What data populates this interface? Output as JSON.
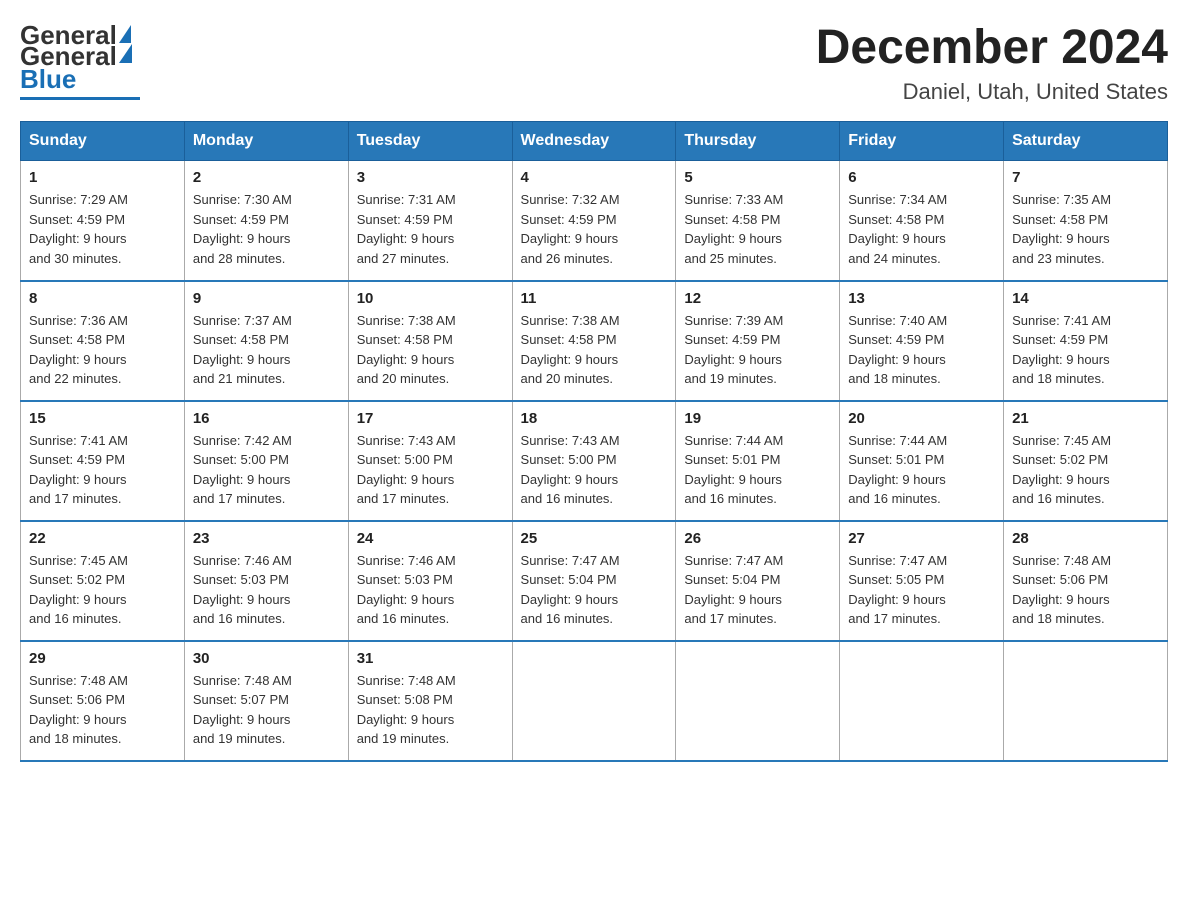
{
  "header": {
    "logo_general": "General",
    "logo_blue": "Blue",
    "month": "December 2024",
    "location": "Daniel, Utah, United States"
  },
  "days_of_week": [
    "Sunday",
    "Monday",
    "Tuesday",
    "Wednesday",
    "Thursday",
    "Friday",
    "Saturday"
  ],
  "weeks": [
    [
      {
        "day": "1",
        "sunrise": "7:29 AM",
        "sunset": "4:59 PM",
        "daylight": "9 hours and 30 minutes."
      },
      {
        "day": "2",
        "sunrise": "7:30 AM",
        "sunset": "4:59 PM",
        "daylight": "9 hours and 28 minutes."
      },
      {
        "day": "3",
        "sunrise": "7:31 AM",
        "sunset": "4:59 PM",
        "daylight": "9 hours and 27 minutes."
      },
      {
        "day": "4",
        "sunrise": "7:32 AM",
        "sunset": "4:59 PM",
        "daylight": "9 hours and 26 minutes."
      },
      {
        "day": "5",
        "sunrise": "7:33 AM",
        "sunset": "4:58 PM",
        "daylight": "9 hours and 25 minutes."
      },
      {
        "day": "6",
        "sunrise": "7:34 AM",
        "sunset": "4:58 PM",
        "daylight": "9 hours and 24 minutes."
      },
      {
        "day": "7",
        "sunrise": "7:35 AM",
        "sunset": "4:58 PM",
        "daylight": "9 hours and 23 minutes."
      }
    ],
    [
      {
        "day": "8",
        "sunrise": "7:36 AM",
        "sunset": "4:58 PM",
        "daylight": "9 hours and 22 minutes."
      },
      {
        "day": "9",
        "sunrise": "7:37 AM",
        "sunset": "4:58 PM",
        "daylight": "9 hours and 21 minutes."
      },
      {
        "day": "10",
        "sunrise": "7:38 AM",
        "sunset": "4:58 PM",
        "daylight": "9 hours and 20 minutes."
      },
      {
        "day": "11",
        "sunrise": "7:38 AM",
        "sunset": "4:58 PM",
        "daylight": "9 hours and 20 minutes."
      },
      {
        "day": "12",
        "sunrise": "7:39 AM",
        "sunset": "4:59 PM",
        "daylight": "9 hours and 19 minutes."
      },
      {
        "day": "13",
        "sunrise": "7:40 AM",
        "sunset": "4:59 PM",
        "daylight": "9 hours and 18 minutes."
      },
      {
        "day": "14",
        "sunrise": "7:41 AM",
        "sunset": "4:59 PM",
        "daylight": "9 hours and 18 minutes."
      }
    ],
    [
      {
        "day": "15",
        "sunrise": "7:41 AM",
        "sunset": "4:59 PM",
        "daylight": "9 hours and 17 minutes."
      },
      {
        "day": "16",
        "sunrise": "7:42 AM",
        "sunset": "5:00 PM",
        "daylight": "9 hours and 17 minutes."
      },
      {
        "day": "17",
        "sunrise": "7:43 AM",
        "sunset": "5:00 PM",
        "daylight": "9 hours and 17 minutes."
      },
      {
        "day": "18",
        "sunrise": "7:43 AM",
        "sunset": "5:00 PM",
        "daylight": "9 hours and 16 minutes."
      },
      {
        "day": "19",
        "sunrise": "7:44 AM",
        "sunset": "5:01 PM",
        "daylight": "9 hours and 16 minutes."
      },
      {
        "day": "20",
        "sunrise": "7:44 AM",
        "sunset": "5:01 PM",
        "daylight": "9 hours and 16 minutes."
      },
      {
        "day": "21",
        "sunrise": "7:45 AM",
        "sunset": "5:02 PM",
        "daylight": "9 hours and 16 minutes."
      }
    ],
    [
      {
        "day": "22",
        "sunrise": "7:45 AM",
        "sunset": "5:02 PM",
        "daylight": "9 hours and 16 minutes."
      },
      {
        "day": "23",
        "sunrise": "7:46 AM",
        "sunset": "5:03 PM",
        "daylight": "9 hours and 16 minutes."
      },
      {
        "day": "24",
        "sunrise": "7:46 AM",
        "sunset": "5:03 PM",
        "daylight": "9 hours and 16 minutes."
      },
      {
        "day": "25",
        "sunrise": "7:47 AM",
        "sunset": "5:04 PM",
        "daylight": "9 hours and 16 minutes."
      },
      {
        "day": "26",
        "sunrise": "7:47 AM",
        "sunset": "5:04 PM",
        "daylight": "9 hours and 17 minutes."
      },
      {
        "day": "27",
        "sunrise": "7:47 AM",
        "sunset": "5:05 PM",
        "daylight": "9 hours and 17 minutes."
      },
      {
        "day": "28",
        "sunrise": "7:48 AM",
        "sunset": "5:06 PM",
        "daylight": "9 hours and 18 minutes."
      }
    ],
    [
      {
        "day": "29",
        "sunrise": "7:48 AM",
        "sunset": "5:06 PM",
        "daylight": "9 hours and 18 minutes."
      },
      {
        "day": "30",
        "sunrise": "7:48 AM",
        "sunset": "5:07 PM",
        "daylight": "9 hours and 19 minutes."
      },
      {
        "day": "31",
        "sunrise": "7:48 AM",
        "sunset": "5:08 PM",
        "daylight": "9 hours and 19 minutes."
      },
      null,
      null,
      null,
      null
    ]
  ],
  "labels": {
    "sunrise": "Sunrise:",
    "sunset": "Sunset:",
    "daylight": "Daylight:"
  }
}
